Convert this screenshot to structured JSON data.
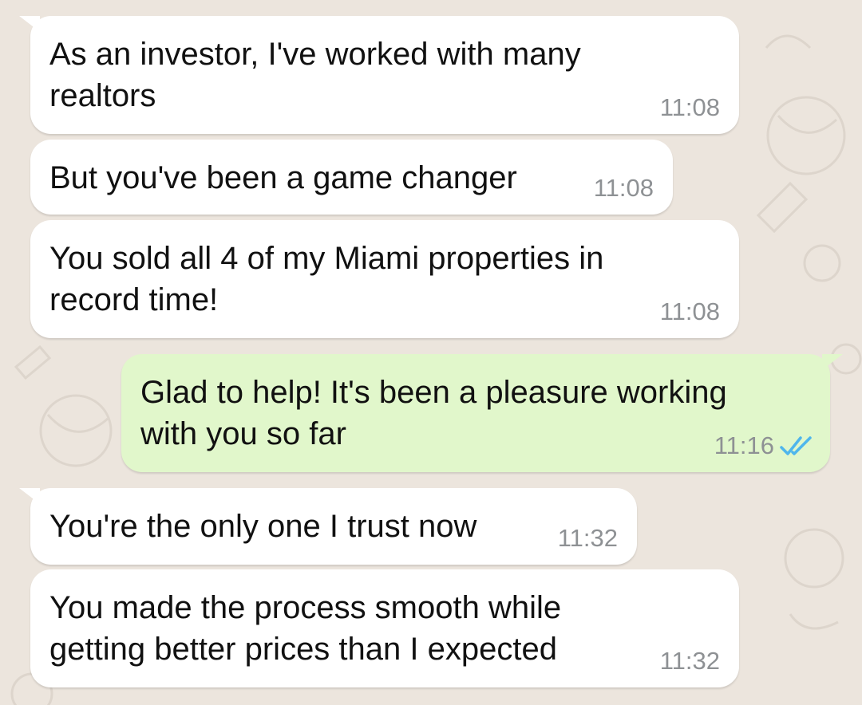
{
  "messages": [
    {
      "direction": "incoming",
      "lines": [
        "As an investor, I've worked with many",
        "realtors"
      ],
      "time": "11:08"
    },
    {
      "direction": "incoming",
      "lines": [
        "But you've been a game changer"
      ],
      "time": "11:08"
    },
    {
      "direction": "incoming",
      "lines": [
        "You sold all 4 of my Miami properties in",
        "record time!"
      ],
      "time": "11:08"
    },
    {
      "direction": "outgoing",
      "lines": [
        "Glad to help! It's been a pleasure working",
        "with you so far"
      ],
      "time": "11:16",
      "status": "read"
    },
    {
      "direction": "incoming",
      "lines": [
        "You're the only one I trust now"
      ],
      "time": "11:32"
    },
    {
      "direction": "incoming",
      "lines": [
        "You made the process smooth while",
        "getting better prices than I expected"
      ],
      "time": "11:32"
    }
  ],
  "colors": {
    "background": "#ece5dd",
    "incoming_bubble": "#ffffff",
    "outgoing_bubble": "#e1f7cb",
    "timestamp": "#8e9194",
    "read_ticks": "#4fb6ec"
  },
  "icons": {
    "read_status": "double-check-icon"
  }
}
